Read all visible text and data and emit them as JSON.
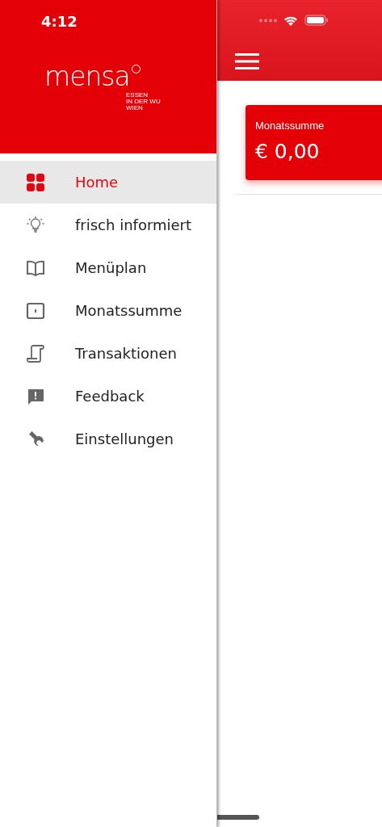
{
  "status_bar": {
    "time": "4:12"
  },
  "drawer": {
    "logo": {
      "wordmark": "mensa",
      "tagline": [
        "ESSEN",
        "IN DER WU",
        "WIEN"
      ]
    },
    "items": [
      {
        "label": "Home",
        "kind": "grid",
        "selected": true
      },
      {
        "label": "frisch informiert",
        "kind": "bulb",
        "selected": false
      },
      {
        "label": "Menüplan",
        "kind": "book",
        "selected": false
      },
      {
        "label": "Monatssumme",
        "kind": "wallet",
        "selected": false
      },
      {
        "label": "Transaktionen",
        "kind": "scroll",
        "selected": false
      },
      {
        "label": "Feedback",
        "kind": "feedback",
        "selected": false
      },
      {
        "label": "Einstellungen",
        "kind": "wrench",
        "selected": false
      }
    ]
  },
  "main": {
    "card": {
      "label": "Monatssumme",
      "amount": "€ 0,00"
    }
  }
}
